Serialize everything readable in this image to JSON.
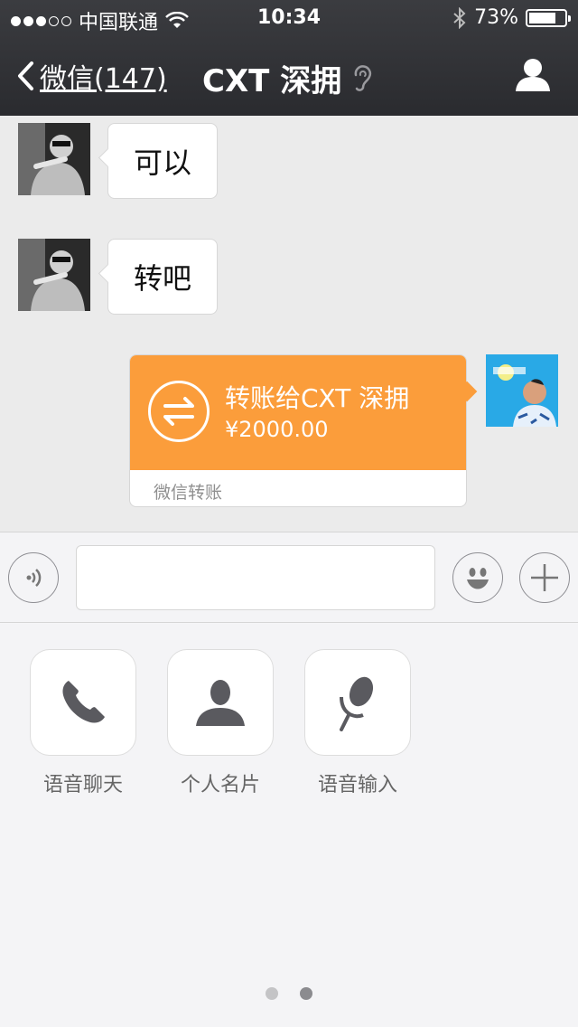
{
  "status_bar": {
    "carrier": "中国联通",
    "time": "10:34",
    "battery": "73%",
    "battery_level": 0.73,
    "signal_bars": 3
  },
  "nav": {
    "back_label": "微信(147)",
    "title": "CXT 深拥"
  },
  "messages": [
    {
      "side": "left",
      "text": "可以"
    },
    {
      "side": "left",
      "text": "转吧"
    }
  ],
  "transfer": {
    "title": "转账给CXT 深拥",
    "amount": "¥2000.00",
    "footer": "微信转账"
  },
  "tools": [
    {
      "label": "语音聊天",
      "icon": "phone-icon"
    },
    {
      "label": "个人名片",
      "icon": "contact-card-icon"
    },
    {
      "label": "语音输入",
      "icon": "microphone-icon"
    }
  ],
  "pager": {
    "pages": 2,
    "current": 2
  },
  "colors": {
    "header": "#2f3034",
    "transfer": "#fb9d3b",
    "chat_bg": "#ebebeb"
  }
}
